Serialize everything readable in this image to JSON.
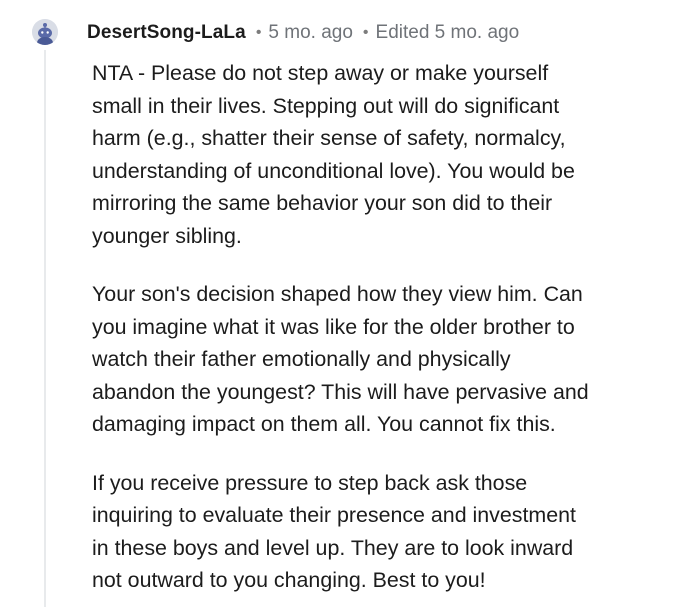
{
  "comment": {
    "author": "DesertSong-LaLa",
    "posted_ago": "5 mo. ago",
    "edited_label": "Edited 5 mo. ago",
    "separator": "•",
    "paragraphs": [
      {
        "lines": [
          "NTA - Please do not step away or make yourself",
          "small in their lives. Stepping out will do significant",
          "harm (e.g., shatter their sense of safety, normalcy,",
          "understanding of unconditional love). You would be",
          "mirroring the same behavior your son did to their",
          "younger sibling."
        ]
      },
      {
        "lines": [
          "Your son's decision shaped how they view him. Can",
          "you imagine what it was like for the older brother to",
          "watch their father emotionally and physically",
          "abandon the youngest? This will have pervasive and",
          "damaging impact on them all. You cannot fix this."
        ]
      },
      {
        "lines": [
          "If you receive pressure to step back ask those",
          "inquiring to evaluate their presence and investment",
          "in these boys and level up. They are to look inward",
          "not outward to you changing. Best to you!"
        ]
      }
    ]
  },
  "avatar_icon": "snoo-avatar-icon",
  "colors": {
    "text": "#1c1c1c",
    "meta": "#6f7378",
    "thread_line": "#e8eaec",
    "avatar_bg": "#d9dde6",
    "avatar_figure": "#5a6aa8"
  }
}
